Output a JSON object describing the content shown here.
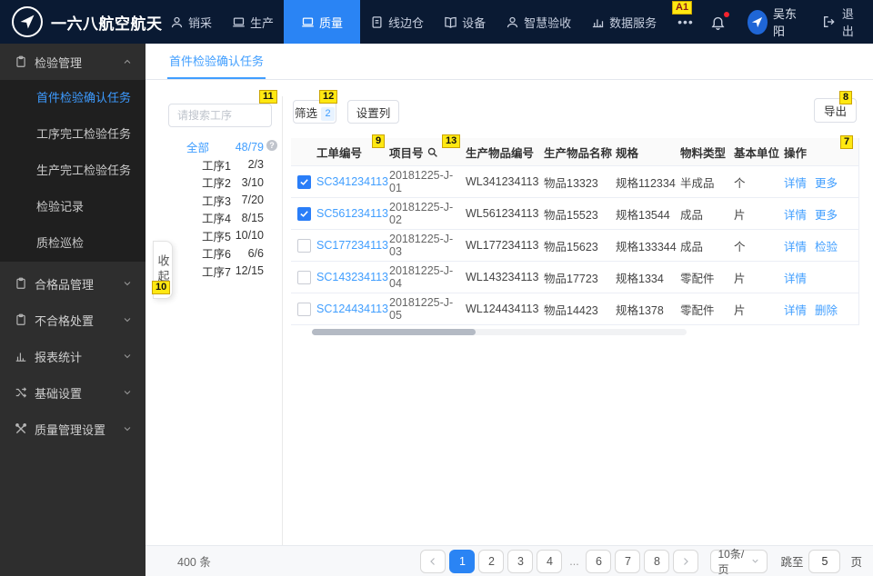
{
  "colors": {
    "accent": "#409eff",
    "nav_bg": "#0a1a33",
    "nav_active_bg": "#2a84f4",
    "sidebar_bg": "#2e2e2e",
    "annotation_yellow": "#ffe812",
    "notification_dot": "#f5222d"
  },
  "annotations": {
    "a1": "A1",
    "n7": "7",
    "n8": "8",
    "n9": "9",
    "n10": "10",
    "n11": "11",
    "n12": "12",
    "n13": "13"
  },
  "navbar": {
    "brand": "一六八航空航天",
    "items": [
      {
        "label": "销采",
        "icon": "user-icon"
      },
      {
        "label": "生产",
        "icon": "monitor-icon"
      },
      {
        "label": "质量",
        "icon": "monitor-icon",
        "active": true
      },
      {
        "label": "线边仓",
        "icon": "document-icon"
      },
      {
        "label": "设备",
        "icon": "book-icon"
      },
      {
        "label": "智慧验收",
        "icon": "user-icon"
      },
      {
        "label": "数据服务",
        "icon": "chart-icon"
      }
    ],
    "more_label": "•••",
    "username": "吴东阳",
    "logout_label": "退出"
  },
  "sidebar": {
    "groups": [
      {
        "label": "检验管理",
        "icon": "clipboard-icon",
        "expanded": true
      },
      {
        "label": "合格品管理",
        "icon": "clipboard-icon"
      },
      {
        "label": "不合格处置",
        "icon": "clipboard-icon"
      },
      {
        "label": "报表统计",
        "icon": "chart-icon"
      },
      {
        "label": "基础设置",
        "icon": "shuffle-icon"
      },
      {
        "label": "质量管理设置",
        "icon": "tools-icon"
      }
    ],
    "submenu": [
      {
        "label": "首件检验确认任务",
        "active": true
      },
      {
        "label": "工序完工检验任务"
      },
      {
        "label": "生产完工检验任务"
      },
      {
        "label": "检验记录"
      },
      {
        "label": "质检巡检"
      }
    ]
  },
  "tabs": {
    "active_tab": "首件检验确认任务"
  },
  "filter_panel": {
    "search_placeholder": "请搜索工序",
    "all_label": "全部",
    "all_count": "48/79",
    "help_glyph": "?",
    "collapse_label": "收起",
    "items": [
      {
        "name": "工序1",
        "count": "2/3"
      },
      {
        "name": "工序2",
        "count": "3/10"
      },
      {
        "name": "工序3",
        "count": "7/20"
      },
      {
        "name": "工序4",
        "count": "8/15"
      },
      {
        "name": "工序5",
        "count": "10/10"
      },
      {
        "name": "工序6",
        "count": "6/6"
      },
      {
        "name": "工序7",
        "count": "12/15"
      }
    ]
  },
  "toolbar": {
    "filter_label": "筛选",
    "filter_count": "2",
    "columns_label": "设置列",
    "export_label": "导出"
  },
  "table": {
    "headers": [
      "工单编号",
      "项目号",
      "生产物品编号",
      "生产物品名称",
      "规格",
      "物料类型",
      "基本单位",
      "操作"
    ],
    "rows": [
      {
        "checked": true,
        "order_no": "SC341234113",
        "project_no": "20181225-J-01",
        "item_code": "WL341234113",
        "item_name": "物品13323",
        "spec": "规格112334",
        "material_type": "半成品",
        "unit": "个",
        "action1": "详情",
        "action2": "更多"
      },
      {
        "checked": true,
        "order_no": "SC561234113",
        "project_no": "20181225-J-02",
        "item_code": "WL561234113",
        "item_name": "物品15523",
        "spec": "规格13544",
        "material_type": "成品",
        "unit": "片",
        "action1": "详情",
        "action2": "更多"
      },
      {
        "checked": false,
        "order_no": "SC177234113",
        "project_no": "20181225-J-03",
        "item_code": "WL177234113",
        "item_name": "物品15623",
        "spec": "规格133344",
        "material_type": "成品",
        "unit": "个",
        "action1": "详情",
        "action2": "检验"
      },
      {
        "checked": false,
        "order_no": "SC143234113",
        "project_no": "20181225-J-04",
        "item_code": "WL143234113",
        "item_name": "物品17723",
        "spec": "规格1334",
        "material_type": "零配件",
        "unit": "片",
        "action1": "详情"
      },
      {
        "checked": false,
        "order_no": "SC124434113",
        "project_no": "20181225-J-05",
        "item_code": "WL124434113",
        "item_name": "物品14423",
        "spec": "规格1378",
        "material_type": "零配件",
        "unit": "片",
        "action1": "详情",
        "action2": "删除"
      }
    ]
  },
  "footer": {
    "total": "400 条",
    "pages": [
      "1",
      "2",
      "3",
      "4",
      "...",
      "6",
      "7",
      "8"
    ],
    "page_size": "10条/页",
    "jump_label": "跳至",
    "jump_value": "5",
    "page_unit": "页"
  }
}
